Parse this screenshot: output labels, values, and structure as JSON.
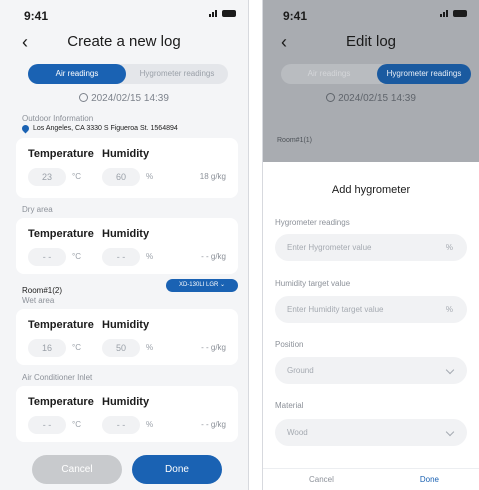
{
  "colors": {
    "accent": "#1a62b3",
    "cancel": "#c8cacd"
  },
  "left": {
    "time": "9:41",
    "title": "Create a new log",
    "tabs": [
      "Air readings",
      "Hygrometer readings"
    ],
    "date": "2024/02/15 14:39",
    "outdoor": {
      "section": "Outdoor Information",
      "location": "Los Angeles, CA  3330 S Figueroa St.  1564894",
      "temperature_label": "Temperature",
      "humidity_label": "Humidity",
      "temp": "23",
      "temp_unit": "°C",
      "hum": "60",
      "hum_unit": "%",
      "gkg": "18 g/kg"
    },
    "dry": {
      "section": "Dry area",
      "temperature_label": "Temperature",
      "humidity_label": "Humidity",
      "temp": "- -",
      "temp_unit": "°C",
      "hum": "- -",
      "hum_unit": "%",
      "gkg": "- - g/kg"
    },
    "room": {
      "name": "Room#1(2)",
      "device": "XD-130LI LGR"
    },
    "wet": {
      "section": "Wet area",
      "temperature_label": "Temperature",
      "humidity_label": "Humidity",
      "temp": "16",
      "temp_unit": "°C",
      "hum": "50",
      "hum_unit": "%",
      "gkg": "- - g/kg"
    },
    "ac": {
      "section": "Air Conditioner Inlet",
      "temperature_label": "Temperature",
      "humidity_label": "Humidity",
      "temp": "- -",
      "temp_unit": "°C",
      "hum": "- -",
      "hum_unit": "%",
      "gkg": "- - g/kg"
    },
    "cancel": "Cancel",
    "done": "Done"
  },
  "right": {
    "time": "9:41",
    "title": "Edit log",
    "tabs": [
      "Air readings",
      "Hygrometer readings"
    ],
    "date": "2024/02/15 14:39",
    "room": "Room#1(1)",
    "sheet": {
      "heading": "Add hygrometer",
      "hyg_label": "Hygrometer readings",
      "hyg_placeholder": "Enter Hygrometer value",
      "hyg_suffix": "%",
      "target_label": "Humidity target value",
      "target_placeholder": "Enter Humidity target value",
      "target_suffix": "%",
      "position_label": "Position",
      "position_value": "Ground",
      "material_label": "Material",
      "material_value": "Wood",
      "cancel": "Cancel",
      "done": "Done"
    }
  }
}
